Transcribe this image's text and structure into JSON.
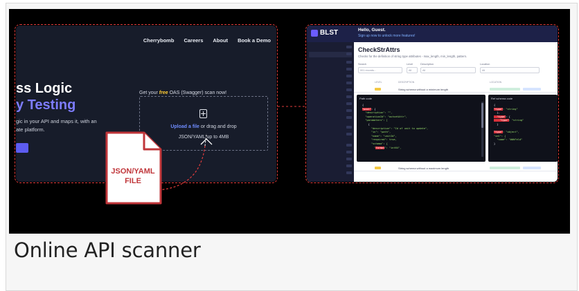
{
  "caption": "Online API scanner",
  "landing": {
    "nav": [
      "Cherrybomb",
      "Careers",
      "About",
      "Book a Demo"
    ],
    "headline_line1": "ss Logic",
    "headline_line2": "y Testing",
    "sub_line1": "gic in your API and maps it, with an",
    "sub_line2": "ate platform.",
    "scan_prefix": "Get your ",
    "scan_free": "free",
    "scan_suffix": " OAS (Swagger) scan now!",
    "upload_link": "Upload a file",
    "upload_rest": " or drag and drop",
    "upload_limit": "JSON/YAML up to 4MB"
  },
  "file_icon": {
    "label_line1": "JSON/YAML",
    "label_line2": "FILE"
  },
  "app": {
    "brand": "BLST",
    "greeting": "Hello, Guest.",
    "signup": "Sign up now to unlock more features!",
    "title": "CheckStrAttrs",
    "description": "Checks for the definition of string type attributes - max_length, min_length, pattern.",
    "filters": {
      "search_label": "Search",
      "search_placeholder": "001 records...",
      "level_label": "Level",
      "level_value": "All",
      "description_label": "Description",
      "description_value": "All",
      "location_label": "Location",
      "location_value": "All"
    },
    "columns": [
      "LEVEL",
      "DESCRIPTION",
      "LOCATION"
    ],
    "row1_description": "String schema without a minimum length",
    "row2_description": "String schema without a maximum length",
    "path_pane_title": "Path code",
    "ref_pane_title": "Ref schema code"
  },
  "colors": {
    "accent_red": "#e23c3c",
    "file_red": "#c0363a",
    "purple": "#7d7cff",
    "free_yellow": "#ffcc33"
  }
}
